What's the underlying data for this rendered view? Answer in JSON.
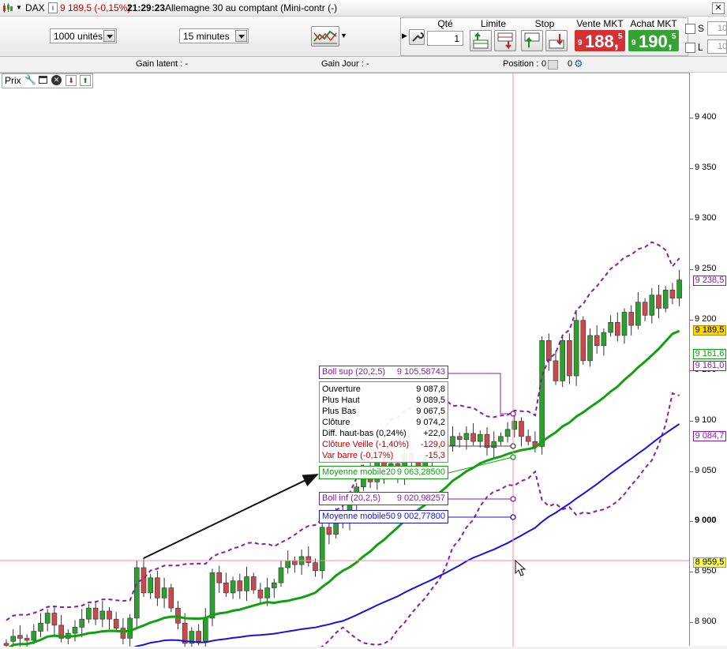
{
  "title": {
    "symbol": "DAX",
    "price_change": "9 189,5 (-0,15%)",
    "time": "21:29:23",
    "instrument": "Allemagne 30 au comptant (Mini-contr (-)"
  },
  "toolbar": {
    "units_value": "1000 unités",
    "timeframe_value": "15 minutes",
    "qty_header": "Qté",
    "qty_value": "1",
    "limit_header": "Limite",
    "stop_header": "Stop",
    "sell_header": "Vente MKT",
    "buy_header": "Achat MKT",
    "sell_prefix": "9",
    "sell_main": "188,",
    "sell_sup": "5",
    "buy_prefix": "9",
    "buy_main": "190,",
    "buy_sup": "5",
    "s_label": "S",
    "l_label": "L",
    "s_value": "10",
    "l_value": "10"
  },
  "infobar": {
    "gain_latent": "Gain latent :  -",
    "gain_jour": "Gain Jour :  -",
    "position_label": "Position :",
    "position_a": "0",
    "position_b": "0"
  },
  "chart_panel": {
    "label": "Prix"
  },
  "axis_ticks": [
    "9 400",
    "9 350",
    "9 300",
    "9 250",
    "9 200",
    "9 150",
    "9 100",
    "9 050",
    "9 000",
    "8 950",
    "8 900"
  ],
  "axis_markers": {
    "boll_sup": "9 238,5",
    "last_price": "9 189,5",
    "ma20": "9 161,6",
    "boll_mid": "9 161,0",
    "ma50": "9 084,7",
    "crosshair": "8 959,5"
  },
  "tooltips": {
    "boll_sup": {
      "label": "Boll sup (20,2,5)",
      "value": "9 105,58743"
    },
    "ohlc": [
      {
        "label": "Ouverture",
        "value": "9 087,8"
      },
      {
        "label": "Plus Haut",
        "value": "9 089,5"
      },
      {
        "label": "Plus Bas",
        "value": "9 067,5"
      },
      {
        "label": "Clôture",
        "value": "9 074,2"
      },
      {
        "label": "Diff. haut-bas (0,24%)",
        "value": "+22,0"
      },
      {
        "label": "Clôture Veille (-1,40%)",
        "value": "-129,0"
      },
      {
        "label": "Var barre (-0,17%)",
        "value": "-15,3"
      }
    ],
    "ma20": {
      "label": "Moyenne mobile20",
      "value": "9 063,28500"
    },
    "boll_inf": {
      "label": "Boll inf (20,2,5)",
      "value": "9 020,98257"
    },
    "ma50": {
      "label": "Moyenne mobile50",
      "value": "9 002,77800"
    }
  },
  "colors": {
    "up_candle": "#2e9e2e",
    "down_candle": "#c84b4b",
    "ma20": "#12a012",
    "ma50": "#1414e0",
    "bollinger": "#8c1aa8",
    "crosshair": "#ff8aa8",
    "sell_bg": "#d23232",
    "buy_bg": "#34a334"
  },
  "chart_data": {
    "type": "candlestick",
    "instrument": "DAX",
    "timeframe": "15 minutes",
    "ylim": [
      8875,
      9420
    ],
    "grid": false,
    "candles": [
      {
        "o": 8880,
        "c": 8878
      },
      {
        "o": 8882,
        "c": 8887
      },
      {
        "o": 8888,
        "c": 8885
      },
      {
        "o": 8885,
        "c": 8883
      },
      {
        "o": 8883,
        "c": 8892
      },
      {
        "o": 8892,
        "c": 8900
      },
      {
        "o": 8900,
        "c": 8910
      },
      {
        "o": 8910,
        "c": 8898
      },
      {
        "o": 8898,
        "c": 8885
      },
      {
        "o": 8885,
        "c": 8890
      },
      {
        "o": 8890,
        "c": 8896
      },
      {
        "o": 8896,
        "c": 8904
      },
      {
        "o": 8904,
        "c": 8915
      },
      {
        "o": 8915,
        "c": 8904
      },
      {
        "o": 8904,
        "c": 8912
      },
      {
        "o": 8912,
        "c": 8904
      },
      {
        "o": 8904,
        "c": 8895
      },
      {
        "o": 8895,
        "c": 8885
      },
      {
        "o": 8885,
        "c": 8905
      },
      {
        "o": 8905,
        "c": 8955
      },
      {
        "o": 8955,
        "c": 8930
      },
      {
        "o": 8930,
        "c": 8945
      },
      {
        "o": 8945,
        "c": 8925
      },
      {
        "o": 8925,
        "c": 8935
      },
      {
        "o": 8935,
        "c": 8915
      },
      {
        "o": 8915,
        "c": 8900
      },
      {
        "o": 8900,
        "c": 8880
      },
      {
        "o": 8880,
        "c": 8892
      },
      {
        "o": 8892,
        "c": 8882
      },
      {
        "o": 8882,
        "c": 8905
      },
      {
        "o": 8905,
        "c": 8950
      },
      {
        "o": 8950,
        "c": 8940
      },
      {
        "o": 8940,
        "c": 8930
      },
      {
        "o": 8930,
        "c": 8942
      },
      {
        "o": 8942,
        "c": 8932
      },
      {
        "o": 8932,
        "c": 8946
      },
      {
        "o": 8946,
        "c": 8933
      },
      {
        "o": 8933,
        "c": 8925
      },
      {
        "o": 8925,
        "c": 8935
      },
      {
        "o": 8935,
        "c": 8940
      },
      {
        "o": 8940,
        "c": 8955
      },
      {
        "o": 8955,
        "c": 8962
      },
      {
        "o": 8962,
        "c": 8958
      },
      {
        "o": 8958,
        "c": 8966
      },
      {
        "o": 8966,
        "c": 8960
      },
      {
        "o": 8960,
        "c": 8952
      },
      {
        "o": 8952,
        "c": 8995
      },
      {
        "o": 8995,
        "c": 8988
      },
      {
        "o": 8988,
        "c": 9010
      },
      {
        "o": 9010,
        "c": 9000
      },
      {
        "o": 9000,
        "c": 9020
      },
      {
        "o": 9020,
        "c": 9035
      },
      {
        "o": 9035,
        "c": 9050
      },
      {
        "o": 9050,
        "c": 9040
      },
      {
        "o": 9040,
        "c": 9060
      },
      {
        "o": 9060,
        "c": 9048
      },
      {
        "o": 9048,
        "c": 9058
      },
      {
        "o": 9058,
        "c": 9045
      },
      {
        "o": 9045,
        "c": 9068
      },
      {
        "o": 9068,
        "c": 9060
      },
      {
        "o": 9060,
        "c": 9052
      },
      {
        "o": 9052,
        "c": 9062
      },
      {
        "o": 9062,
        "c": 9070
      },
      {
        "o": 9070,
        "c": 9080
      },
      {
        "o": 9080,
        "c": 9076
      },
      {
        "o": 9076,
        "c": 9085
      },
      {
        "o": 9085,
        "c": 9082
      },
      {
        "o": 9082,
        "c": 9088
      },
      {
        "o": 9088,
        "c": 9080
      },
      {
        "o": 9080,
        "c": 9087
      },
      {
        "o": 9087,
        "c": 9074
      },
      {
        "o": 9074,
        "c": 9080
      },
      {
        "o": 9080,
        "c": 9085
      },
      {
        "o": 9085,
        "c": 9092
      },
      {
        "o": 9092,
        "c": 9100
      },
      {
        "o": 9100,
        "c": 9085
      },
      {
        "o": 9085,
        "c": 9080
      },
      {
        "o": 9080,
        "c": 9075
      },
      {
        "o": 9075,
        "c": 9180
      },
      {
        "o": 9180,
        "c": 9160
      },
      {
        "o": 9160,
        "c": 9140
      },
      {
        "o": 9140,
        "c": 9180
      },
      {
        "o": 9180,
        "c": 9145
      },
      {
        "o": 9145,
        "c": 9200
      },
      {
        "o": 9200,
        "c": 9160
      },
      {
        "o": 9160,
        "c": 9185
      },
      {
        "o": 9185,
        "c": 9175
      },
      {
        "o": 9175,
        "c": 9188
      },
      {
        "o": 9188,
        "c": 9198
      },
      {
        "o": 9198,
        "c": 9185
      },
      {
        "o": 9185,
        "c": 9208
      },
      {
        "o": 9208,
        "c": 9195
      },
      {
        "o": 9195,
        "c": 9218
      },
      {
        "o": 9218,
        "c": 9205
      },
      {
        "o": 9205,
        "c": 9225
      },
      {
        "o": 9225,
        "c": 9212
      },
      {
        "o": 9212,
        "c": 9230
      },
      {
        "o": 9230,
        "c": 9222
      },
      {
        "o": 9222,
        "c": 9240
      }
    ]
  }
}
